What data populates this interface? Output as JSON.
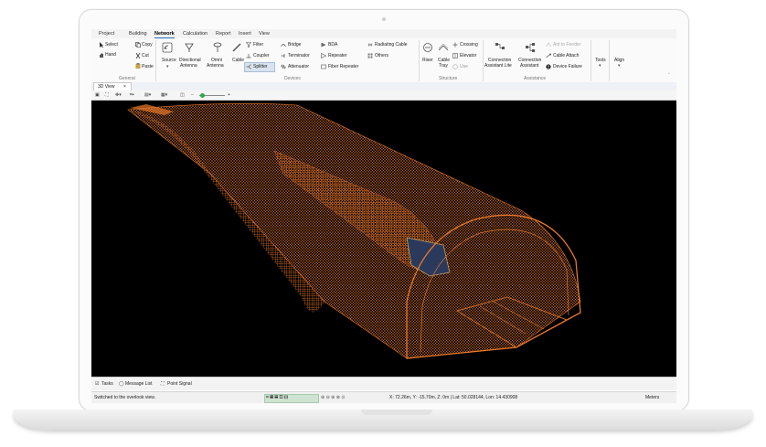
{
  "menu": [
    "Project",
    "Building",
    "Network",
    "Calculation",
    "Report",
    "Insert",
    "View"
  ],
  "ribbon": {
    "general": {
      "select": "Select",
      "hand": "Hand",
      "copy": "Copy",
      "cut": "Cut",
      "paste": "Paste",
      "label": "General"
    },
    "devices": {
      "source": "Source",
      "directional": "Directional",
      "antenna": "Antenna",
      "omni": "Omni",
      "cable": "Cable",
      "filter": "Filter",
      "coupler": "Coupler",
      "splitter": "Splitter",
      "bridge": "Bridge",
      "terminator": "Terminator",
      "attenuator": "Attenuator",
      "bda": "BDA",
      "repeater": "Repeater",
      "fiber_repeater": "Fiber Repeater",
      "radiating_cable": "Radiating Cable",
      "others": "Others",
      "label": "Devices"
    },
    "structure": {
      "riser": "Riser",
      "cable": "Cable",
      "tray": "Tray",
      "crossing": "Crossing",
      "elevator": "Elevator",
      "use": "Use",
      "label": "Structure"
    },
    "assistance": {
      "conn_lite_1": "Connection",
      "conn_lite_2": "Assistant Lite",
      "conn_1": "Connection",
      "conn_2": "Assistant",
      "ant_to_feeder": "Ant to Feeder",
      "cable_attach": "Cable Attach",
      "device_failure": "Device Failure",
      "label": "Assistance"
    },
    "tools": "Tools",
    "align": "Align"
  },
  "tab": {
    "label": "3D View",
    "close": "×"
  },
  "bottom": {
    "tasks": "Tasks",
    "messages": "Message List",
    "point_signal": "Point Signal"
  },
  "status": {
    "message": "Switched to the overlook view.",
    "coords": "X: 72.26m, Y: -15.70m, Z: 0m | Lat: 50.028144, Lon: 14.430908",
    "units": "Meters"
  },
  "colors": {
    "mesh": "#e8782a",
    "train": "#c8603a",
    "viewport": "#000000",
    "accent": "#2b6cb0"
  }
}
